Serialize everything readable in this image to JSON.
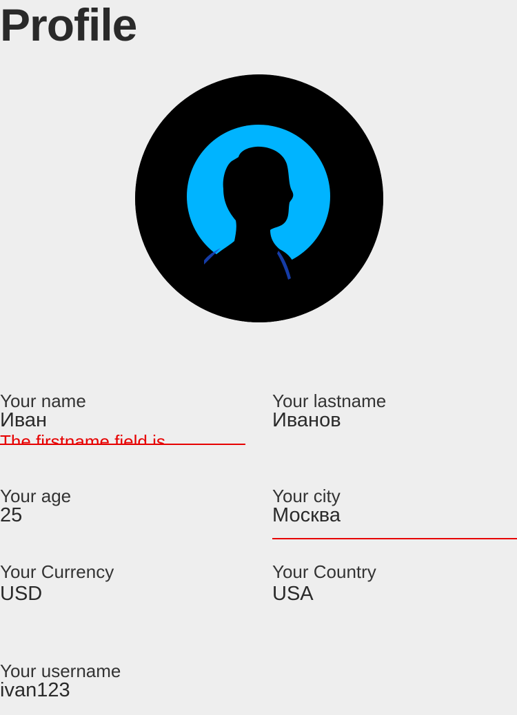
{
  "page": {
    "title": "Profile"
  },
  "avatar": {
    "icon": "person-silhouette-icon",
    "background": "#000000",
    "halo_color": "#00b4ff"
  },
  "fields": {
    "firstname": {
      "label": "Your name",
      "value": "Иван",
      "error": "The firstname field is"
    },
    "lastname": {
      "label": "Your lastname",
      "value": "Иванов"
    },
    "age": {
      "label": "Your age",
      "value": "25"
    },
    "city": {
      "label": "Your city",
      "value": "Москва"
    },
    "currency": {
      "label": "Your Currency",
      "value": "USD"
    },
    "country": {
      "label": "Your Country",
      "value": "USA"
    },
    "username": {
      "label": "Your username",
      "value": "ivan123"
    }
  },
  "colors": {
    "background": "#eeeeee",
    "text": "#2a2a2a",
    "error": "#e60000"
  }
}
